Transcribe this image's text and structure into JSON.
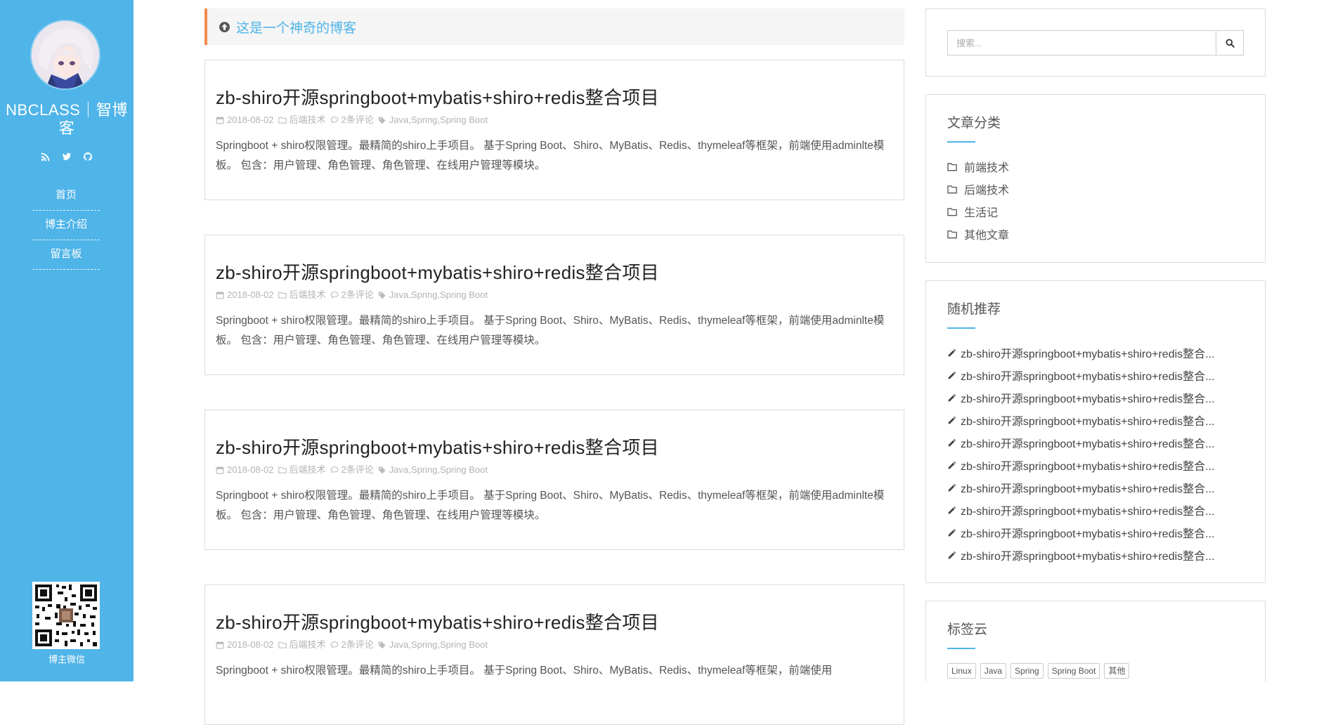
{
  "colors": {
    "accent": "#4fb4e8",
    "notice_border": "#f08b4f",
    "text_dark": "#222222",
    "text_meta": "#b3b3b3"
  },
  "sidebar": {
    "title": "NBCLASS｜智博客",
    "social_icons": [
      "rss-icon",
      "twitter-icon",
      "github-icon"
    ],
    "nav": [
      {
        "label": "首页"
      },
      {
        "label": "博主介绍"
      },
      {
        "label": "留言板"
      }
    ],
    "qr_label": "博主微信"
  },
  "notice": {
    "icon": "arrow-circle-up-icon",
    "text": "这是一个神奇的博客"
  },
  "posts": [
    {
      "title": "zb-shiro开源springboot+mybatis+shiro+redis整合项目",
      "date": "2018-08-02",
      "category": "后端技术",
      "comments": "2条评论",
      "tags": "Java,Spring,Spring Boot",
      "excerpt": "Springboot + shiro权限管理。最精简的shiro上手项目。 基于Spring Boot、Shiro、MyBatis、Redis、thymeleaf等框架，前端使用adminlte模板。 包含：用户管理、角色管理、角色管理、在线用户管理等模块。"
    },
    {
      "title": "zb-shiro开源springboot+mybatis+shiro+redis整合项目",
      "date": "2018-08-02",
      "category": "后端技术",
      "comments": "2条评论",
      "tags": "Java,Spring,Spring Boot",
      "excerpt": "Springboot + shiro权限管理。最精简的shiro上手项目。 基于Spring Boot、Shiro、MyBatis、Redis、thymeleaf等框架，前端使用adminlte模板。 包含：用户管理、角色管理、角色管理、在线用户管理等模块。"
    },
    {
      "title": "zb-shiro开源springboot+mybatis+shiro+redis整合项目",
      "date": "2018-08-02",
      "category": "后端技术",
      "comments": "2条评论",
      "tags": "Java,Spring,Spring Boot",
      "excerpt": "Springboot + shiro权限管理。最精简的shiro上手项目。 基于Spring Boot、Shiro、MyBatis、Redis、thymeleaf等框架，前端使用adminlte模板。 包含：用户管理、角色管理、角色管理、在线用户管理等模块。"
    },
    {
      "title": "zb-shiro开源springboot+mybatis+shiro+redis整合项目",
      "date": "2018-08-02",
      "category": "后端技术",
      "comments": "2条评论",
      "tags": "Java,Spring,Spring Boot",
      "excerpt": "Springboot + shiro权限管理。最精简的shiro上手项目。 基于Spring Boot、Shiro、MyBatis、Redis、thymeleaf等框架，前端使用"
    }
  ],
  "search": {
    "placeholder": "搜索..."
  },
  "categories": {
    "title": "文章分类",
    "items": [
      "前端技术",
      "后端技术",
      "生活记",
      "其他文章"
    ]
  },
  "recommend": {
    "title": "随机推荐",
    "items": [
      "zb-shiro开源springboot+mybatis+shiro+redis整合...",
      "zb-shiro开源springboot+mybatis+shiro+redis整合...",
      "zb-shiro开源springboot+mybatis+shiro+redis整合...",
      "zb-shiro开源springboot+mybatis+shiro+redis整合...",
      "zb-shiro开源springboot+mybatis+shiro+redis整合...",
      "zb-shiro开源springboot+mybatis+shiro+redis整合...",
      "zb-shiro开源springboot+mybatis+shiro+redis整合...",
      "zb-shiro开源springboot+mybatis+shiro+redis整合...",
      "zb-shiro开源springboot+mybatis+shiro+redis整合...",
      "zb-shiro开源springboot+mybatis+shiro+redis整合..."
    ]
  },
  "tag_cloud": {
    "title": "标签云",
    "tags": [
      "Linux",
      "Java",
      "Spring",
      "Spring Boot",
      "其他"
    ]
  }
}
